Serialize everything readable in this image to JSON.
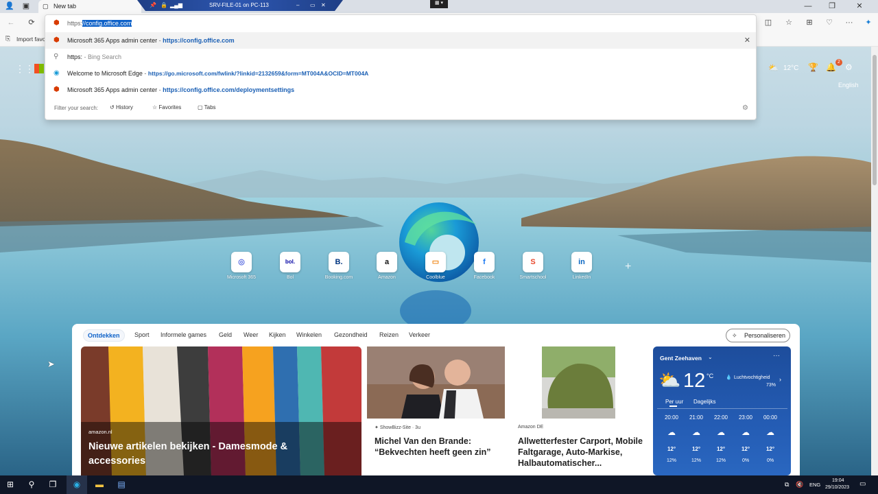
{
  "browser": {
    "tab_title": "New tab",
    "rdp_title": "SRV-FILE-01 on PC-113",
    "favorites_bar_first": "Import favo"
  },
  "omnibox": {
    "typed_prefix": "https:",
    "typed_selected": "//config.office.com",
    "suggestions": [
      {
        "title": "Microsoft 365 Apps admin center",
        "sep": " - ",
        "url": "https://config.office.com"
      },
      {
        "title": "https:",
        "sep": " - ",
        "url": "Bing Search"
      },
      {
        "title": "Welcome to Microsoft Edge",
        "sep": " - ",
        "url": "https://go.microsoft.com/fwlink/?linkid=2132659&form=MT004A&OCID=MT004A"
      },
      {
        "title": "Microsoft 365 Apps admin center",
        "sep": " - ",
        "url": "https://config.office.com/deploymentsettings"
      }
    ],
    "filter_label": "Filter your search:",
    "filter_options": [
      "History",
      "Favorites",
      "Tabs"
    ]
  },
  "header": {
    "weather_temp": "12°C",
    "language": "English",
    "notification_count": "2"
  },
  "quick_links": [
    {
      "label": "Microsoft 365",
      "glyph": "◎",
      "color": "#5b6ee1"
    },
    {
      "label": "Bol",
      "glyph": "bol.",
      "color": "#0000a4"
    },
    {
      "label": "Booking.com",
      "glyph": "B.",
      "color": "#003580"
    },
    {
      "label": "Amazon",
      "glyph": "a",
      "color": "#111111"
    },
    {
      "label": "Coolblue",
      "glyph": "▭",
      "color": "#f08a1c"
    },
    {
      "label": "Facebook",
      "glyph": "f",
      "color": "#1877f2"
    },
    {
      "label": "Smartschool",
      "glyph": "S",
      "color": "#e8492d"
    },
    {
      "label": "LinkedIn",
      "glyph": "in",
      "color": "#0a66c2"
    }
  ],
  "add_shortcut": "+",
  "feed": {
    "tabs": [
      "Ontdekken",
      "Sport",
      "Informele games",
      "Geld",
      "Weer",
      "Kijken",
      "Winkelen",
      "Gezondheid",
      "Reizen",
      "Verkeer"
    ],
    "personalize_label": "Personaliseren",
    "cards": [
      {
        "source": "amazon.nl",
        "title": "Nieuwe artikelen bekijken - Damesmode & accessories"
      },
      {
        "source": "ShowBizz-Site · 3u",
        "title": "Michel Van den Brande: “Bekvechten heeft geen zin”"
      },
      {
        "source": "Amazon DE",
        "title": "Allwetterfester Carport, Mobile Faltgarage, Auto-Markise, Halbautomatischer..."
      }
    ]
  },
  "weather": {
    "location": "Gent Zeehaven",
    "temperature": "12",
    "unit": "°C",
    "humidity_label": "Luchtvochtigheid",
    "humidity_value": "73%",
    "tabs": [
      "Per uur",
      "Dagelijks"
    ],
    "hours": [
      {
        "time": "20:00",
        "temp": "12°",
        "rain": "12%"
      },
      {
        "time": "21:00",
        "temp": "12°",
        "rain": "12%"
      },
      {
        "time": "22:00",
        "temp": "12°",
        "rain": "12%"
      },
      {
        "time": "23:00",
        "temp": "12°",
        "rain": "0%"
      },
      {
        "time": "00:00",
        "temp": "12°",
        "rain": "0%"
      }
    ]
  },
  "taskbar": {
    "lang": "ENG",
    "time": "19:04",
    "date": "29/10/2023"
  }
}
